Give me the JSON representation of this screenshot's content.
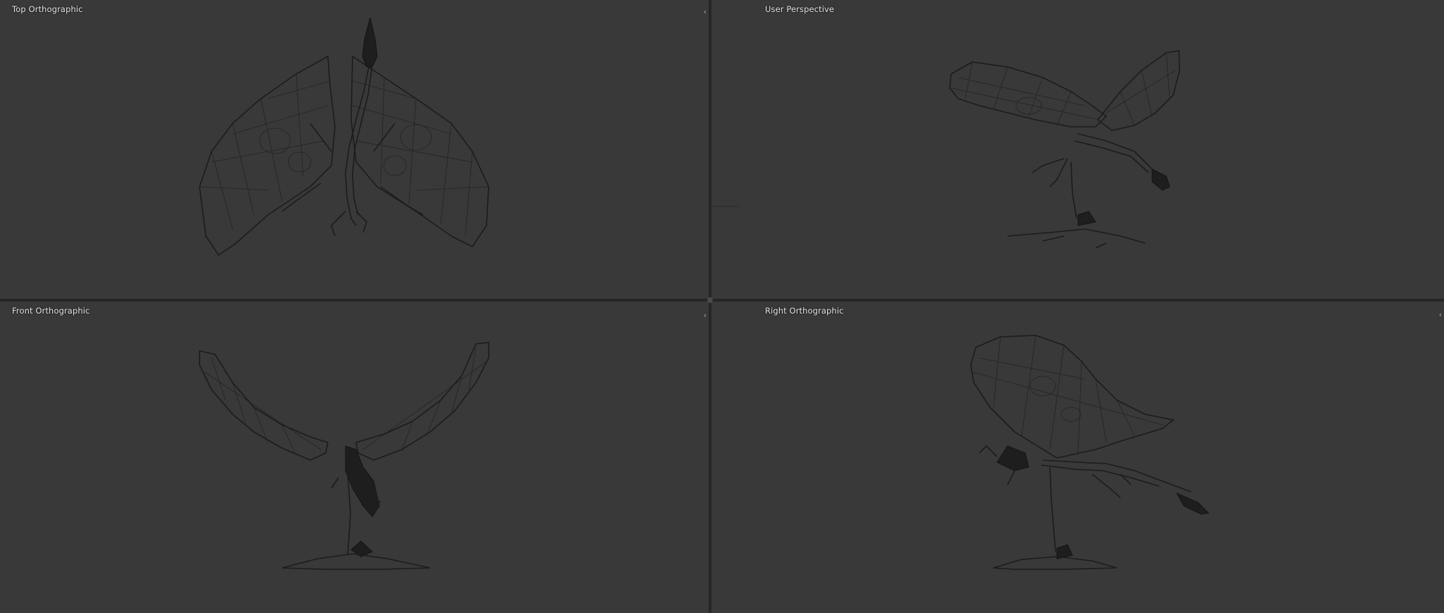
{
  "app": {
    "name": "3D modeling viewport (quad view)"
  },
  "viewports": {
    "top_left": {
      "label": "Top Orthographic"
    },
    "top_right": {
      "label": "User Perspective"
    },
    "bottom_left": {
      "label": "Front Orthographic"
    },
    "bottom_right": {
      "label": "Right Orthographic"
    }
  },
  "icons": {
    "collapse": "chevron-left-icon"
  },
  "colors": {
    "viewport_bg": "#393939",
    "separator": "#262626",
    "wire": "#1c1c1c",
    "label_text": "#e6e6e6"
  }
}
